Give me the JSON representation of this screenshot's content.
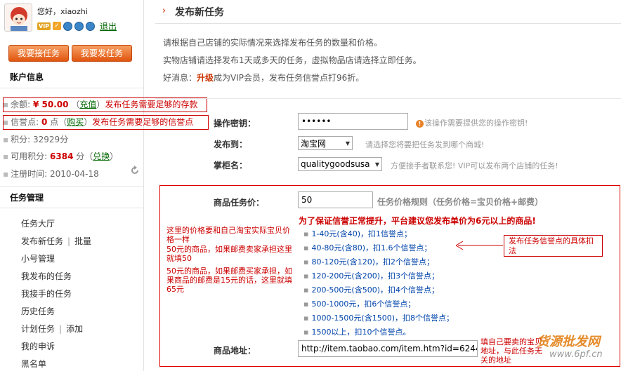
{
  "user": {
    "greeting": "您好，xiaozhi",
    "vip_badge": "VIP",
    "logout_label": "退出"
  },
  "buttons": {
    "accept_task": "我要接任务",
    "publish_task": "我要发任务"
  },
  "account": {
    "heading": "账户信息",
    "balance_label": "余额:",
    "balance_value": "¥ 50.00",
    "recharge_link": "充值",
    "balance_note": "发布任务需要足够的存款",
    "rep_label": "信誉点:",
    "rep_value": "0",
    "rep_unit": "点",
    "buy_link": "购买",
    "rep_note": "发布任务需要足够的信誉点",
    "points_label": "积分:",
    "points_value": "32929分",
    "usable_label": "可用积分:",
    "usable_value": "6384",
    "usable_unit": "分",
    "exchange_link": "兑换",
    "reg_label": "注册时间:",
    "reg_value": "2010-04-18"
  },
  "task_menu": {
    "heading": "任务管理",
    "items": [
      "任务大厅",
      "发布新任务",
      "批量",
      "小号管理",
      "我发布的任务",
      "我接手的任务",
      "历史任务",
      "计划任务",
      "添加",
      "我的申诉",
      "黑名单"
    ]
  },
  "page": {
    "title": "发布新任务",
    "intro1": "请根据自己店铺的实际情况来选择发布任务的数量和价格。",
    "intro2": "实物店铺请选择发布1天或多天的任务，虚拟物品店请选择立即任务。",
    "intro3_prefix": "好消息：",
    "intro3_link": "升级",
    "intro3_suffix": "成为VIP会员，发布任务信誉点打96折。"
  },
  "form": {
    "password_label": "操作密钥：",
    "password_value": "••••••",
    "password_hint": "该操作需要提供您的操作密钥!",
    "publish_to_label": "发布到：",
    "publish_to_value": "淘宝网",
    "publish_to_hint": "请选择您将要把任务发到哪个商城!",
    "shopkeeper_label": "掌柜名：",
    "shopkeeper_value": "qualitygoodsusa",
    "shopkeeper_hint": "方便接手者联系您! VIP可以发布两个店铺的任务!",
    "price_label": "商品任务价：",
    "price_value": "50",
    "price_rule": "任务价格规则（任务价格=宝贝价格+邮费）",
    "suggestion": "为了保证信誉正常提升，平台建议您发布单价为6元以上的商品!",
    "tiers": [
      "1-40元(含40)，扣1信誉点；",
      "40-80元(含80)，扣1.6个信誉点；",
      "80-120元(含120)，扣2个信誉点；",
      "120-200元(含200)，扣3个信誉点；",
      "200-500元(含500)，扣4个信誉点；",
      "500-1000元，扣6个信誉点；",
      "1000-1500元(含1500)，扣8个信誉点；",
      "1500以上，扣10个信誉点。"
    ],
    "address_label": "商品地址：",
    "address_value": "http://item.taobao.com/item.htm?id=6244184"
  },
  "annotations": {
    "note1": "这里的价格要和自己淘宝实际宝贝价格一样",
    "note2": "50元的商品，如果邮费卖家承担这里就填50",
    "note3": "50元的商品，如果邮费买家承担，如果商品的邮费是15元的话，这里就填65元",
    "explain": "发布任务信誉点的具体扣法",
    "address_note": "填自己要卖的宝贝地址，与此任务无关的地址"
  },
  "watermark": {
    "top": "货源批发网",
    "bottom": "www.6pf.cn"
  },
  "colors": {
    "accent_red": "#cc0000",
    "button_orange": "#e1550f",
    "link_green": "#006600",
    "tier_blue": "#0044aa"
  }
}
